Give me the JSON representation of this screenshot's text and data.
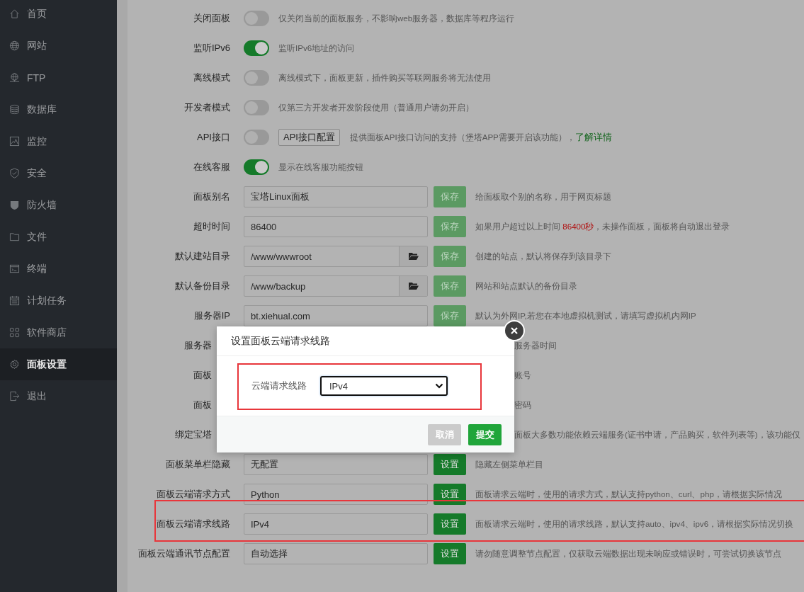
{
  "sidebar": {
    "items": [
      {
        "label": "首页",
        "selected": false
      },
      {
        "label": "网站",
        "selected": false
      },
      {
        "label": "FTP",
        "selected": false
      },
      {
        "label": "数据库",
        "selected": false
      },
      {
        "label": "监控",
        "selected": false
      },
      {
        "label": "安全",
        "selected": false
      },
      {
        "label": "防火墙",
        "selected": false
      },
      {
        "label": "文件",
        "selected": false
      },
      {
        "label": "终端",
        "selected": false
      },
      {
        "label": "计划任务",
        "selected": false
      },
      {
        "label": "软件商店",
        "selected": false
      },
      {
        "label": "面板设置",
        "selected": true
      },
      {
        "label": "退出",
        "selected": false
      }
    ]
  },
  "settings": {
    "toggles": [
      {
        "label": "关闭面板",
        "on": false,
        "description": "仅关闭当前的面板服务，不影响web服务器，数据库等程序运行"
      },
      {
        "label": "监听IPv6",
        "on": true,
        "description": "监听IPv6地址的访问"
      },
      {
        "label": "离线模式",
        "on": false,
        "description": "离线模式下，面板更新，插件购买等联网服务将无法使用"
      },
      {
        "label": "开发者模式",
        "on": false,
        "description": "仅第三方开发者开发阶段使用（普通用户请勿开启）"
      },
      {
        "label": "API接口",
        "on": false,
        "button": "API接口配置",
        "description": "提供面板API接口访问的支持（堡塔APP需要开启该功能），",
        "link": "了解详情"
      },
      {
        "label": "在线客服",
        "on": true,
        "description": "显示在线客服功能按钮"
      }
    ],
    "fields": [
      {
        "kind": "field",
        "label": "面板别名",
        "value": "宝塔Linux面板",
        "button": "保存",
        "disabled": true,
        "description": "给面板取个别的名称，用于网页标题"
      },
      {
        "kind": "field",
        "label": "超时时间",
        "value": "86400",
        "button": "保存",
        "disabled": true,
        "description": "如果用户超过以上时间 ",
        "warning": "86400秒",
        "description_end": "，未操作面板，面板将自动退出登录"
      },
      {
        "kind": "field",
        "label": "默认建站目录",
        "value": "/www/wwwroot",
        "browse": true,
        "button": "保存",
        "disabled": true,
        "description": "创建的站点，默认将保存到该目录下"
      },
      {
        "kind": "field",
        "label": "默认备份目录",
        "value": "/www/backup",
        "browse": true,
        "button": "保存",
        "disabled": true,
        "description": "网站和站点默认的备份目录"
      },
      {
        "kind": "field",
        "label": "服务器IP",
        "value": "bt.xiehual.com",
        "button": "保存",
        "disabled": true,
        "description": "默认为外网IP,若您在本地虚拟机测试，请填写虚拟机内网IP"
      },
      {
        "kind": "covered",
        "label": "服务器",
        "description": "服务器时间"
      },
      {
        "kind": "covered",
        "label": "面板",
        "description": "账号"
      },
      {
        "kind": "covered",
        "label": "面板",
        "description": "密码"
      },
      {
        "kind": "covered",
        "label": "绑定宝塔",
        "description": "面板大多数功能依赖云端服务(证书申请，产品购买，软件列表等)，该功能仅"
      },
      {
        "kind": "field",
        "label": "面板菜单栏隐藏",
        "value": "无配置",
        "button": "设置",
        "disabled": false,
        "description": "隐藏左侧菜单栏目"
      },
      {
        "kind": "field",
        "label": "面板云端请求方式",
        "value": "Python",
        "button": "设置",
        "disabled": false,
        "description": "面板请求云端时，使用的请求方式，默认支持python、curl、php，请根据实际情况"
      },
      {
        "kind": "field",
        "label": "面板云端请求线路",
        "value": "IPv4",
        "button": "设置",
        "disabled": false,
        "description": "面板请求云端时，使用的请求线路，默认支持auto、ipv4、ipv6，请根据实际情况切换"
      },
      {
        "kind": "field",
        "label": "面板云端通讯节点配置",
        "value": "自动选择",
        "button": "设置",
        "disabled": false,
        "description": "请勿随意调整节点配置，仅获取云端数据出现未响应或错误时，可尝试切换该节点"
      }
    ]
  },
  "dialog": {
    "title": "设置面板云端请求线路",
    "field_label": "云端请求线路",
    "select_value": "IPv4",
    "buttons": [
      {
        "label": "取消",
        "kind": "cancel"
      },
      {
        "label": "提交",
        "kind": "submit"
      }
    ]
  }
}
